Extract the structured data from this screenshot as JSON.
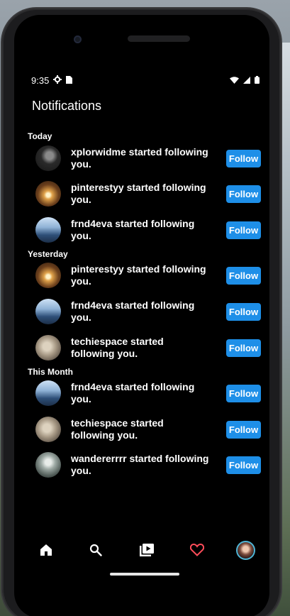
{
  "status": {
    "time": "9:35"
  },
  "header": {
    "title": "Notifications"
  },
  "sections": [
    {
      "label": "Today",
      "items": [
        {
          "username": "xplorwidme",
          "text": "xplorwidme started following you.",
          "button": "Follow",
          "avatar_color": "#3a3a3a"
        },
        {
          "username": "pinterestyy",
          "text": "pinterestyy started following you.",
          "button": "Follow",
          "avatar_color": "#c98a3c"
        },
        {
          "username": "frnd4eva",
          "text": "frnd4eva started following you.",
          "button": "Follow",
          "avatar_color": "#4f7fb0"
        }
      ]
    },
    {
      "label": "Yesterday",
      "items": [
        {
          "username": "pinterestyy",
          "text": "pinterestyy started following you.",
          "button": "Follow",
          "avatar_color": "#c98a3c"
        },
        {
          "username": "frnd4eva",
          "text": "frnd4eva started following you.",
          "button": "Follow",
          "avatar_color": "#4f7fb0"
        },
        {
          "username": "techiespace",
          "text": "techiespace started following you.",
          "button": "Follow",
          "avatar_color": "#a89a86"
        }
      ]
    },
    {
      "label": "This Month",
      "items": [
        {
          "username": "frnd4eva",
          "text": "frnd4eva started following you.",
          "button": "Follow",
          "avatar_color": "#4f7fb0"
        },
        {
          "username": "techiespace",
          "text": "techiespace started following you.",
          "button": "Follow",
          "avatar_color": "#a89a86"
        },
        {
          "username": "wandererrrr",
          "text": "wandererrrr started following you.",
          "button": "Follow",
          "avatar_color": "#6f7d78"
        }
      ]
    }
  ],
  "nav": {
    "items": [
      {
        "name": "home-icon",
        "active": false
      },
      {
        "name": "search-icon",
        "active": false
      },
      {
        "name": "reels-icon",
        "active": false
      },
      {
        "name": "heart-icon",
        "active": true
      },
      {
        "name": "profile-avatar",
        "active": false
      }
    ]
  },
  "colors": {
    "accent": "#1e8fe8",
    "active_tab": "#ff4d5a",
    "background": "#000000",
    "text": "#ffffff"
  }
}
